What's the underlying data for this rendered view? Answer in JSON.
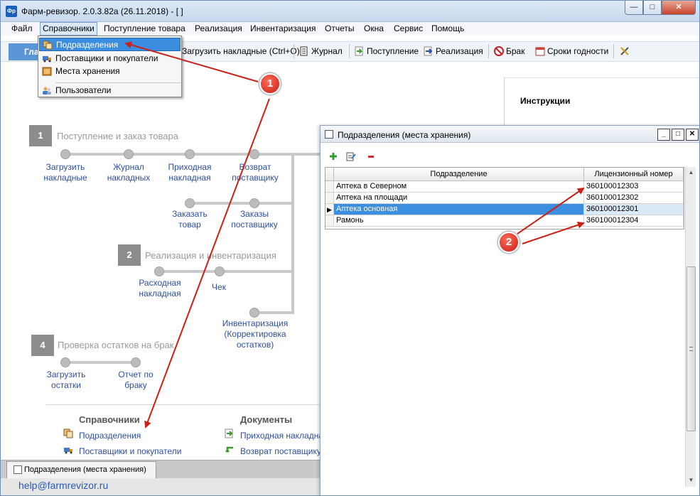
{
  "window": {
    "title": "Фарм-ревизор. 2.0.3.82a (26.11.2018) - [ ]",
    "app_icon": "Фр",
    "controls": {
      "minimize": "—",
      "maximize": "□",
      "close": "✕"
    }
  },
  "menu": [
    "Файл",
    "Справочники",
    "Поступление товара",
    "Реализация",
    "Инвентаризация",
    "Отчеты",
    "Окна",
    "Сервис",
    "Помощь"
  ],
  "toolbar": {
    "main_tab": "Гла",
    "load_invoices": "Загрузить накладные (Ctrl+O)",
    "journal": "Журнал",
    "receipt": "Поступление",
    "sales": "Реализация",
    "defect": "Брак",
    "expiry": "Сроки годности"
  },
  "dropdown": {
    "items": [
      "Подразделения",
      "Поставщики и покупатели",
      "Места хранения",
      "Пользователи"
    ]
  },
  "workflow": {
    "step1": {
      "num": "1",
      "title": "Поступление и заказ товара",
      "nodes": [
        "Загрузить\nнакладные",
        "Журнал\nнакладных",
        "Приходная\nнакладная",
        "Возврат\nпоставщику"
      ],
      "nodes2": [
        "Заказать\nтовар",
        "Заказы\nпоставщику"
      ]
    },
    "step2": {
      "num": "2",
      "title": "Реализация и инвентаризация",
      "nodes": [
        "Расходная\nнакладная",
        "Чек"
      ],
      "node3": "Инвентаризация\n(Корректировка\nостатков)"
    },
    "step4": {
      "num": "4",
      "title": "Проверка остатков на брак",
      "nodes": [
        "Загрузить\nостатки",
        "Отчет по\nбраку"
      ]
    }
  },
  "instructions": {
    "title": "Инструкции"
  },
  "bottom": {
    "refs_title": "Справочники",
    "refs": [
      "Подразделения",
      "Поставщики и покупатели"
    ],
    "docs_title": "Документы",
    "docs": [
      "Приходная накладная",
      "Возврат поставщику"
    ]
  },
  "status": {
    "tab": "Подразделения (места хранения)",
    "help": "help@farmrevizor.ru"
  },
  "child_window": {
    "title": "Подразделения (места хранения)",
    "controls": {
      "minimize": "_",
      "maximize": "□",
      "close": "✕"
    },
    "columns": [
      "Подразделение",
      "Лицензионный номер"
    ],
    "rows": [
      {
        "name": "Аптека в Северном",
        "license": "360100012303"
      },
      {
        "name": "Аптека на площади",
        "license": "360100012302"
      },
      {
        "name": "Аптека основная",
        "license": "360100012301"
      },
      {
        "name": "Рамонь",
        "license": "360100012304"
      }
    ],
    "current_row_marker": "▶",
    "scroll_up": "▲",
    "scroll_down": "▼"
  },
  "callouts": [
    "1",
    "2"
  ],
  "colors": {
    "accent": "#3b8edf",
    "link": "#2c4f9e",
    "callout": "#d6231a",
    "selection": "#3c8ee0"
  }
}
